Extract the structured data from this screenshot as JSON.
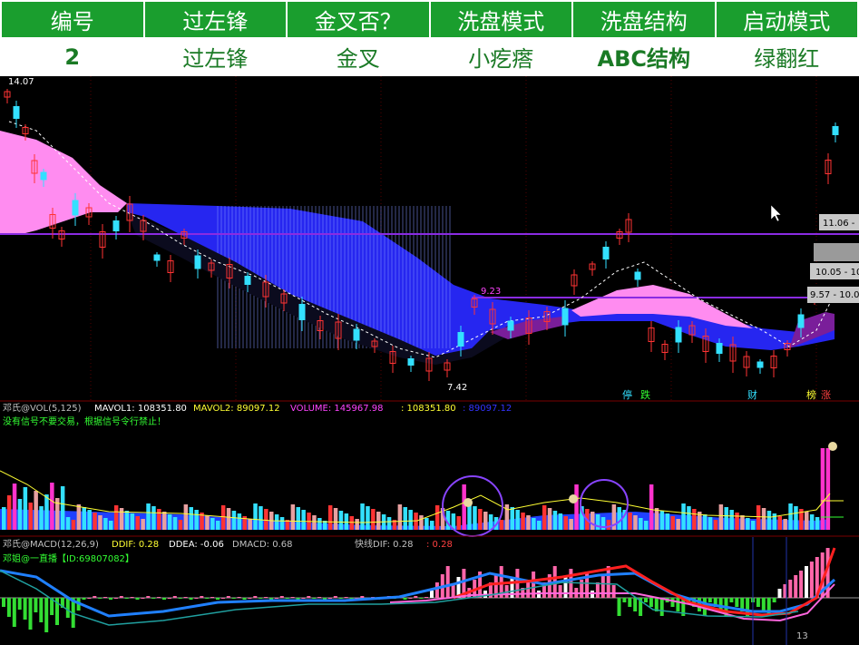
{
  "header": {
    "columns": [
      "编号",
      "过左锋",
      "金叉否？",
      "洗盘模式",
      "洗盘结构",
      "启动模式"
    ],
    "values": [
      "2",
      "过左锋",
      "金叉",
      "小疙瘩",
      "ABC结构",
      "绿翻红"
    ]
  },
  "price_panel": {
    "high_label": "14.07",
    "low_label": "7.42",
    "mid_label": "9.23",
    "price_tags": [
      "11.06 -",
      "10.05 - 10",
      "9.57 - 10.0"
    ],
    "badges": [
      "停",
      "跌",
      "财",
      "榜",
      "涨"
    ],
    "colors": {
      "up": "#ff3333",
      "down": "#33e0ff",
      "cloud_pink": "#ff8cf0",
      "cloud_blue": "#2020ee",
      "line": "#8a2be2"
    }
  },
  "volume_panel": {
    "indicator": "邓氏@VOL(5,125)",
    "mavol1_label": "MAVOL1: 108351.80",
    "mavol2_label": "MAVOL2: 89097.12",
    "volume_label": "VOLUME: 145967.98",
    "extra1_label": ": 108351.80",
    "extra2_label": ": 89097.12",
    "warning": "没有信号不要交易，根据信号令行禁止！"
  },
  "macd_panel": {
    "indicator": "邓氏@MACD(12,26,9)",
    "ddif_label": "DDIF: 0.28",
    "ddea_label": "DDEA: -0.06",
    "dmacd_label": "DMACD: 0.68",
    "fast_label": "快线DIF: 0.28",
    "extra_label": ": 0.28",
    "broadcast": "邓姐@一直播【ID:69807082】",
    "bottom_number": "13"
  }
}
